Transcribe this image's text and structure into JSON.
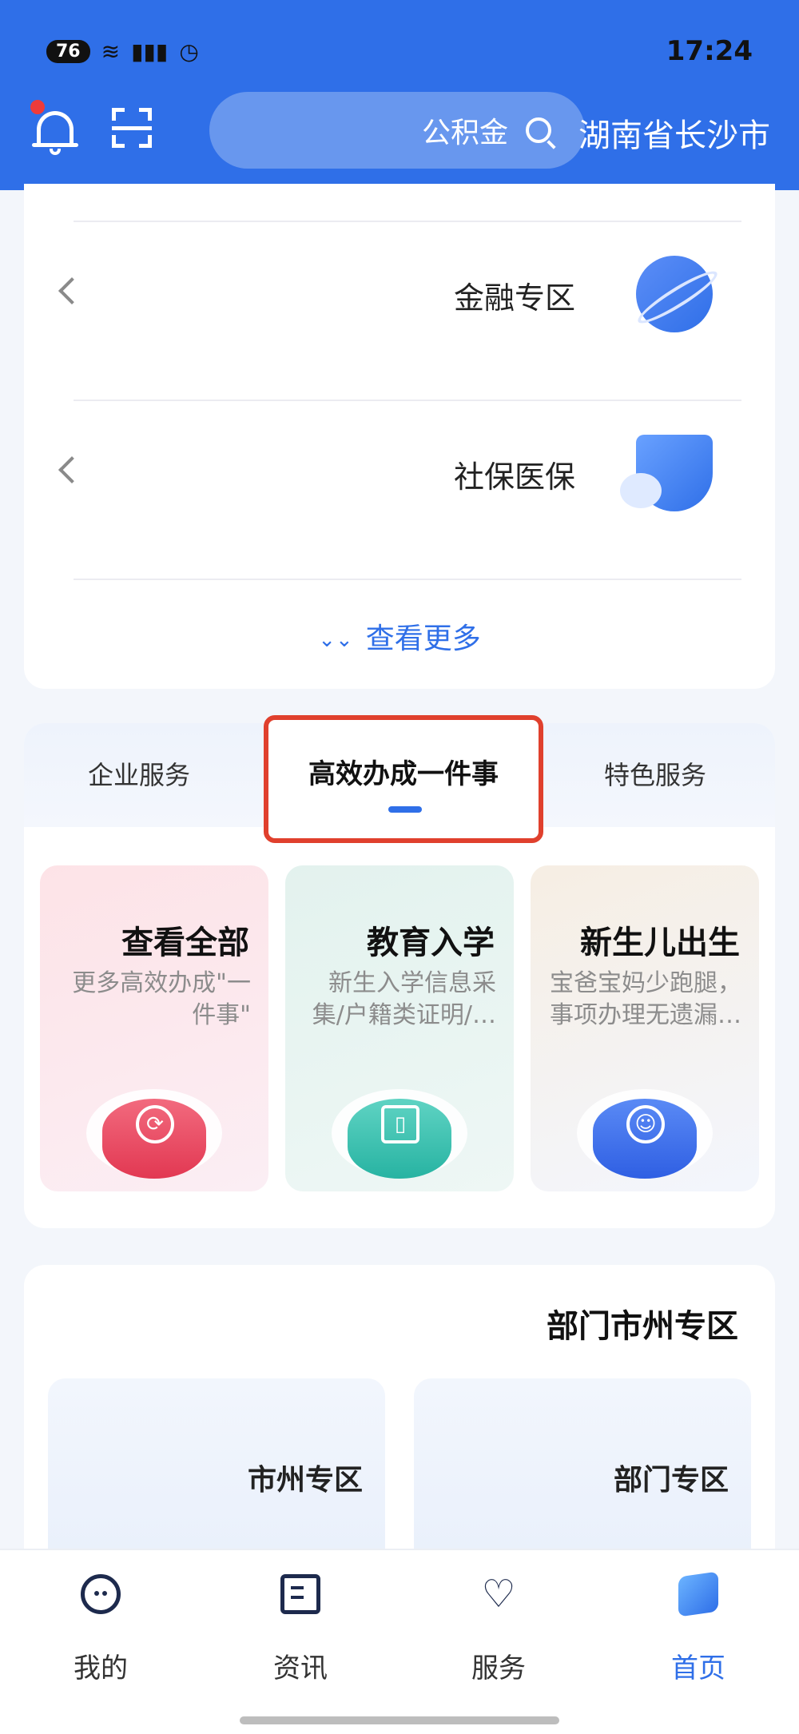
{
  "status_bar": {
    "time": "17:24",
    "battery": "76",
    "network": "5G"
  },
  "header": {
    "city": "湖南省长沙市",
    "search_placeholder": "公积金"
  },
  "service_list": {
    "items": [
      {
        "label": "金融专区",
        "icon": "finance-planet-icon"
      },
      {
        "label": "社保医保",
        "icon": "shield-insurance-icon"
      }
    ],
    "more_label": "查看更多"
  },
  "tabs": {
    "items": [
      "企业服务",
      "高效办成一件事",
      "特色服务"
    ],
    "active": "高效办成一件事"
  },
  "tiles": [
    {
      "title": "查看全部",
      "desc": "更多高效办成\"一件事\"",
      "icon": "refresh-lightning-icon",
      "color": "#e23852"
    },
    {
      "title": "教育入学",
      "desc": "新生入学信息采集/户籍类证明/…",
      "icon": "book-icon",
      "color": "#27b3a2"
    },
    {
      "title": "新生儿出生",
      "desc": "宝爸宝妈少跑腿，事项办理无遗漏…",
      "icon": "baby-icon",
      "color": "#2f5fe3"
    }
  ],
  "dept_section": {
    "title": "部门市州专区",
    "cards": [
      "市州专区",
      "部门专区"
    ]
  },
  "bottom_nav": {
    "items": [
      "我的",
      "资讯",
      "服务",
      "首页"
    ],
    "active": "首页"
  },
  "colors": {
    "brand": "#2f6fe8",
    "highlight_box": "#e0402d"
  }
}
